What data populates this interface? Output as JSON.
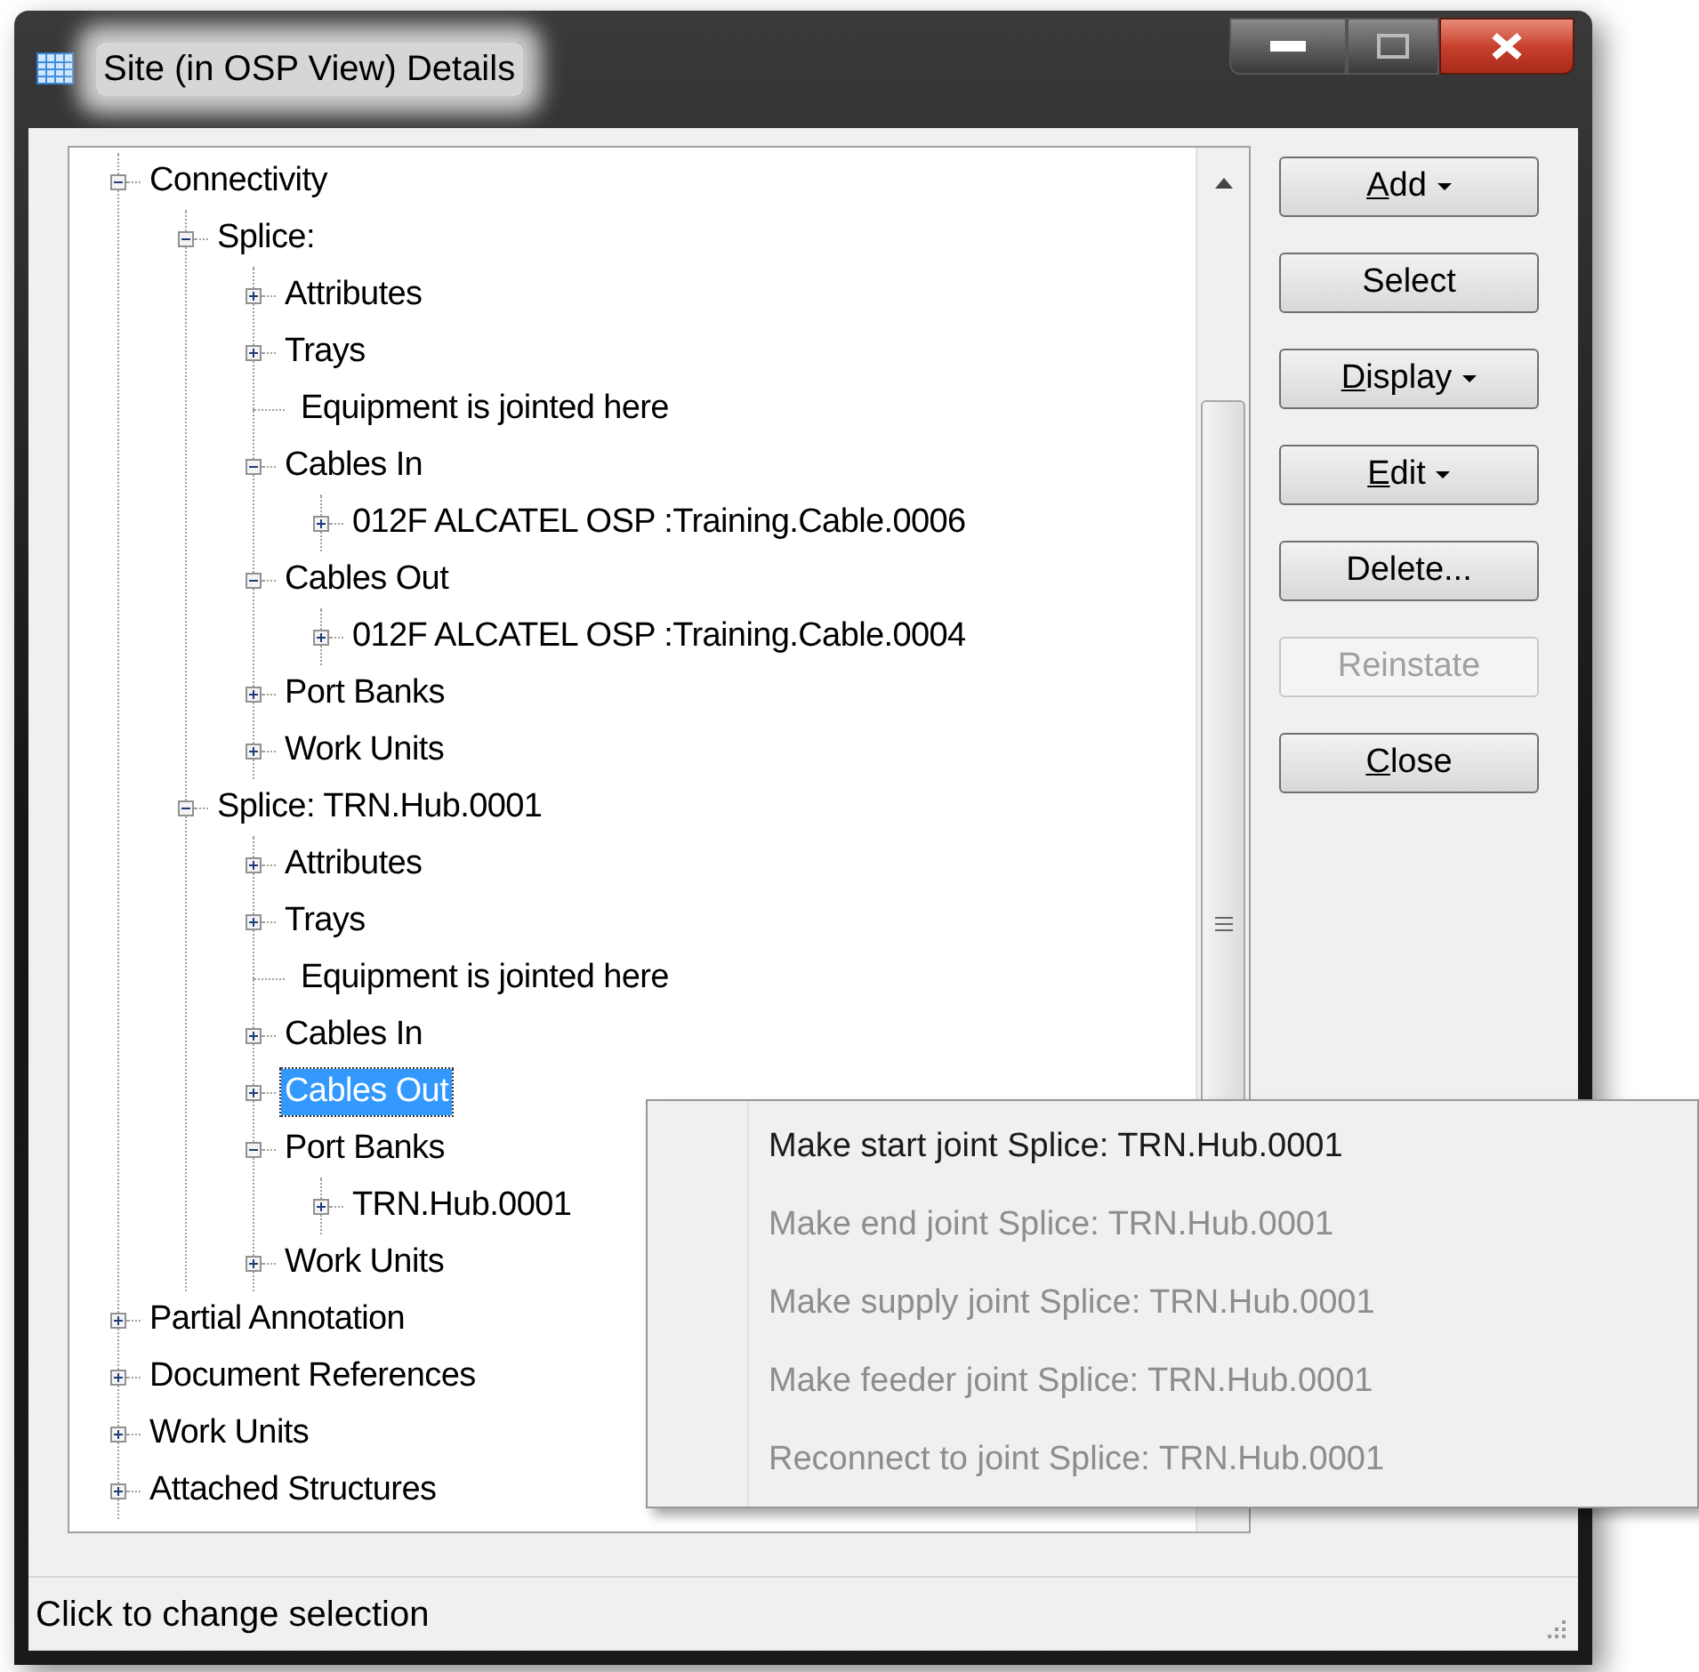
{
  "window": {
    "title": "Site (in OSP View) Details"
  },
  "tree": [
    {
      "label": "Connectivity",
      "kind": "node",
      "expanded": true,
      "selected": false,
      "children": [
        {
          "label": "Splice:",
          "kind": "node",
          "expanded": true,
          "selected": false,
          "children": [
            {
              "label": "Attributes",
              "kind": "node",
              "expanded": false,
              "selected": false
            },
            {
              "label": "Trays",
              "kind": "node",
              "expanded": false,
              "selected": false
            },
            {
              "label": "Equipment is jointed here",
              "kind": "leaf",
              "selected": false
            },
            {
              "label": "Cables In",
              "kind": "node",
              "expanded": true,
              "selected": false,
              "children": [
                {
                  "label": "012F ALCATEL OSP :Training.Cable.0006",
                  "kind": "node",
                  "expanded": false,
                  "selected": false
                }
              ]
            },
            {
              "label": "Cables Out",
              "kind": "node",
              "expanded": true,
              "selected": false,
              "children": [
                {
                  "label": "012F ALCATEL OSP :Training.Cable.0004",
                  "kind": "node",
                  "expanded": false,
                  "selected": false
                }
              ]
            },
            {
              "label": "Port Banks",
              "kind": "node",
              "expanded": false,
              "selected": false
            },
            {
              "label": "Work Units",
              "kind": "node",
              "expanded": false,
              "selected": false
            }
          ]
        },
        {
          "label": "Splice: TRN.Hub.0001",
          "kind": "node",
          "expanded": true,
          "selected": false,
          "children": [
            {
              "label": "Attributes",
              "kind": "node",
              "expanded": false,
              "selected": false
            },
            {
              "label": "Trays",
              "kind": "node",
              "expanded": false,
              "selected": false
            },
            {
              "label": "Equipment is jointed here",
              "kind": "leaf",
              "selected": false
            },
            {
              "label": "Cables In",
              "kind": "node",
              "expanded": false,
              "selected": false
            },
            {
              "label": "Cables Out",
              "kind": "node",
              "expanded": false,
              "selected": true
            },
            {
              "label": "Port Banks",
              "kind": "node",
              "expanded": true,
              "selected": false,
              "children": [
                {
                  "label": "TRN.Hub.0001",
                  "kind": "node",
                  "expanded": false,
                  "selected": false
                }
              ]
            },
            {
              "label": "Work Units",
              "kind": "node",
              "expanded": false,
              "selected": false
            }
          ]
        }
      ]
    },
    {
      "label": "Partial Annotation",
      "kind": "node",
      "expanded": false,
      "selected": false
    },
    {
      "label": "Document References",
      "kind": "node",
      "expanded": false,
      "selected": false
    },
    {
      "label": "Work Units",
      "kind": "node",
      "expanded": false,
      "selected": false
    },
    {
      "label": "Attached Structures",
      "kind": "node",
      "expanded": false,
      "selected": false
    }
  ],
  "buttons": [
    {
      "label": "Add",
      "mnemonic": true,
      "dropdown": true,
      "disabled": false
    },
    {
      "label": "Select",
      "mnemonic": false,
      "dropdown": false,
      "disabled": false
    },
    {
      "label": "Display",
      "mnemonic": true,
      "dropdown": true,
      "disabled": false
    },
    {
      "label": "Edit",
      "mnemonic": true,
      "dropdown": true,
      "disabled": false
    },
    {
      "label": "Delete...",
      "mnemonic": false,
      "dropdown": false,
      "disabled": false
    },
    {
      "label": "Reinstate",
      "mnemonic": false,
      "dropdown": false,
      "disabled": true
    },
    {
      "label": "Close",
      "mnemonic": true,
      "dropdown": false,
      "disabled": false
    }
  ],
  "context_menu": [
    {
      "label": "Make start joint Splice: TRN.Hub.0001",
      "disabled": false
    },
    {
      "label": "Make end joint Splice: TRN.Hub.0001",
      "disabled": true
    },
    {
      "label": "Make supply joint Splice: TRN.Hub.0001",
      "disabled": true
    },
    {
      "label": "Make feeder joint Splice: TRN.Hub.0001",
      "disabled": true
    },
    {
      "label": "Reconnect to joint Splice: TRN.Hub.0001",
      "disabled": true
    }
  ],
  "status_bar": "Click to change selection"
}
